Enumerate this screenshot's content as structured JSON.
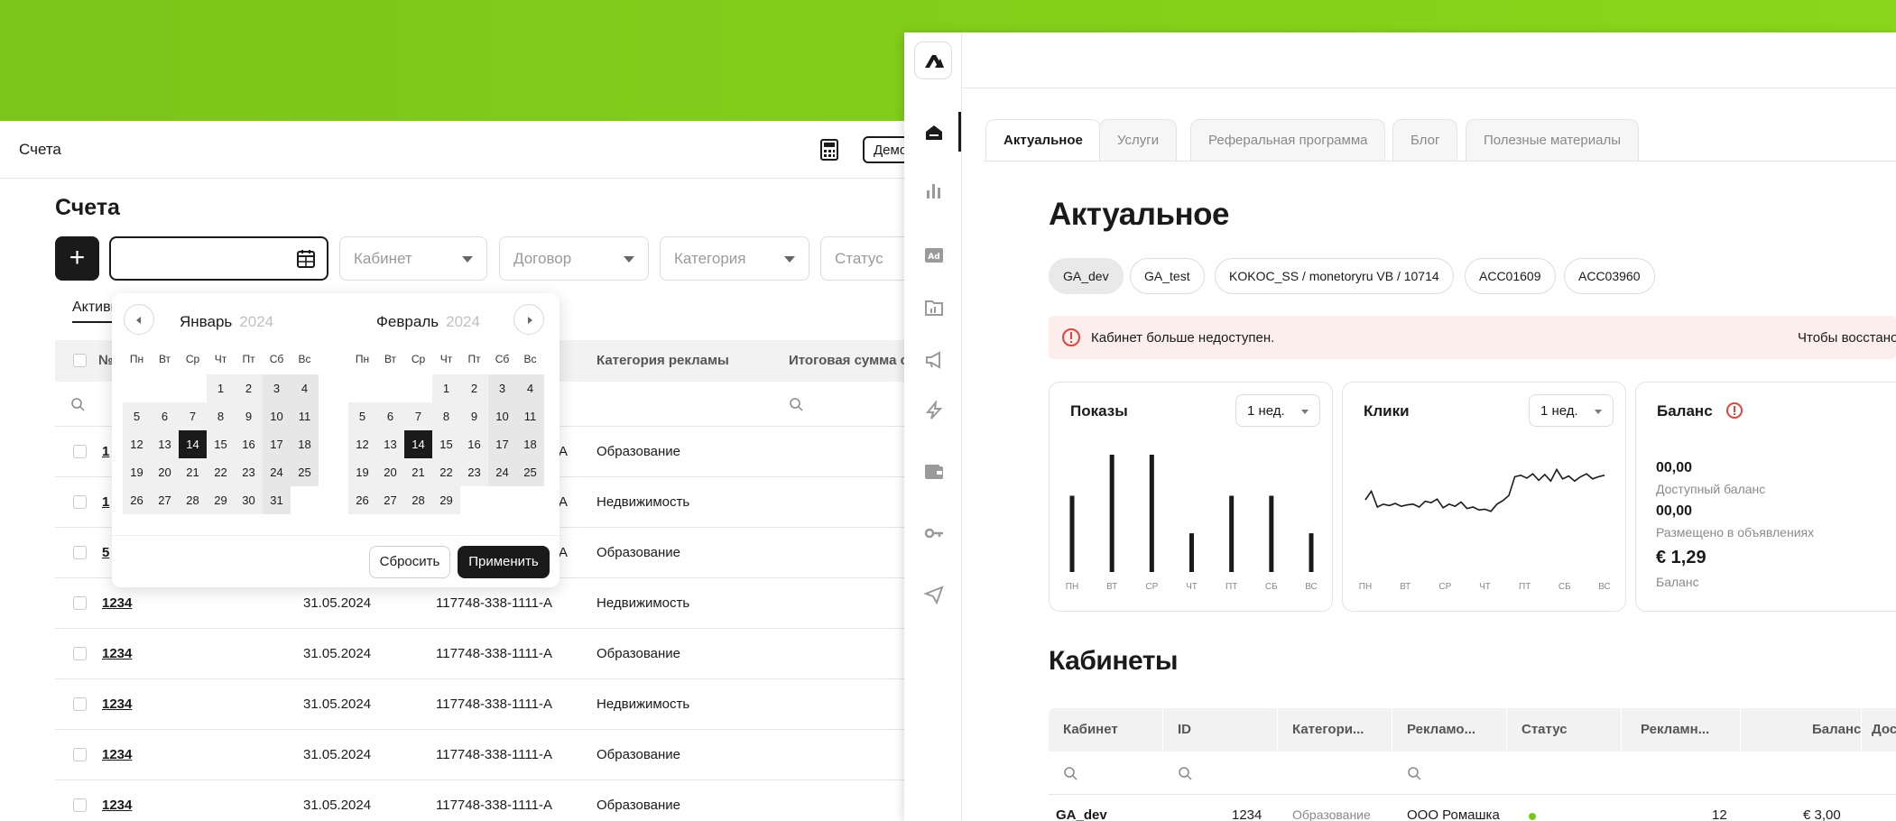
{
  "colors": {
    "brand_green": "#7cc519",
    "dark": "#1a1a1a",
    "alert_bg": "#fdeeee",
    "alert_red": "#e0433b"
  },
  "left": {
    "header_title": "Счета",
    "demo_label": "Демо",
    "page_title": "Счета",
    "add_label": "+",
    "filters": {
      "cabinet": "Кабинет",
      "contract": "Договор",
      "category": "Категория",
      "status": "Статус"
    },
    "tab_active": "Активные",
    "table": {
      "headers": {
        "num": "№",
        "ad_category": "Категория рекламы",
        "total": "Итоговая сумма счета"
      },
      "rows": [
        {
          "num": "1",
          "cat": "Образование",
          "contract_tail": "A"
        },
        {
          "num": "1",
          "cat": "Недвижимость",
          "contract_tail": "A"
        },
        {
          "num": "5",
          "cat": "Образование",
          "contract_tail": "A"
        },
        {
          "num": "1234",
          "date": "31.05.2024",
          "contract": "117748-338-1111-A",
          "cat": "Недвижимость"
        },
        {
          "num": "1234",
          "date": "31.05.2024",
          "contract": "117748-338-1111-A",
          "cat": "Образование"
        },
        {
          "num": "1234",
          "date": "31.05.2024",
          "contract": "117748-338-1111-A",
          "cat": "Недвижимость"
        },
        {
          "num": "1234",
          "date": "31.05.2024",
          "contract": "117748-338-1111-A",
          "cat": "Образование"
        },
        {
          "num": "1234",
          "date": "31.05.2024",
          "contract": "117748-338-1111-A",
          "cat": "Образование"
        }
      ]
    }
  },
  "picker": {
    "weekdays": [
      "Пн",
      "Вт",
      "Ср",
      "Чт",
      "Пт",
      "Сб",
      "Вс"
    ],
    "month1": {
      "name": "Январь",
      "year": "2024"
    },
    "month2": {
      "name": "Февраль",
      "year": "2024"
    },
    "selected_day": "14",
    "reset_label": "Сбросить",
    "apply_label": "Применить"
  },
  "right": {
    "tabs": [
      "Актуальное",
      "Услуги",
      "Реферальная программа",
      "Блог",
      "Полезные материалы"
    ],
    "title": "Актуальное",
    "chips": [
      "GA_dev",
      "GA_test",
      "KOKOC_SS / monetoryru VB / 10714",
      "ACC01609",
      "ACC03960"
    ],
    "alert_text": "Кабинет больше недоступен.",
    "alert_text2": "Чтобы восстано",
    "cards": {
      "shows": {
        "title": "Показы",
        "period": "1 нед."
      },
      "clicks": {
        "title": "Клики",
        "period": "1 нед."
      },
      "balance": {
        "title": "Баланс",
        "available_value": "00,00",
        "available_label": "Доступный баланс",
        "placed_value": "00,00",
        "placed_label": "Размещено в объявлениях",
        "balance_value": "€ 1,29",
        "balance_label": "Баланс"
      }
    },
    "day_labels": [
      "ПН",
      "ВТ",
      "СР",
      "ЧТ",
      "ПТ",
      "СБ",
      "ВС"
    ],
    "cabinets_title": "Кабинеты",
    "cab_headers": [
      "Кабинет",
      "ID",
      "Категори...",
      "Рекламо...",
      "Статус",
      "Рекламн...",
      "Баланс",
      "Дос"
    ],
    "cab_row": {
      "name": "GA_dev",
      "id": "1234",
      "cat": "Образование",
      "adv": "ООО Ромашка",
      "ads": "12",
      "balance": "€ 3,00"
    }
  },
  "chart_data": [
    {
      "type": "bar",
      "title": "Показы",
      "categories": [
        "ПН",
        "ВТ",
        "СР",
        "ЧТ",
        "ПТ",
        "СБ",
        "ВС"
      ],
      "values": [
        65,
        100,
        100,
        33,
        65,
        65,
        33
      ],
      "ylim": [
        0,
        100
      ]
    },
    {
      "type": "line",
      "title": "Клики",
      "x": [
        0,
        1,
        2,
        3,
        4,
        5,
        6,
        7,
        8,
        9,
        10,
        11,
        12,
        13,
        14,
        15,
        16,
        17,
        18,
        19,
        20,
        21,
        22,
        23,
        24,
        25,
        26,
        27,
        28,
        29,
        30,
        31,
        32,
        33,
        34,
        35,
        36,
        37,
        38,
        39,
        40
      ],
      "values": [
        50,
        62,
        40,
        44,
        42,
        45,
        41,
        43,
        44,
        40,
        48,
        46,
        51,
        39,
        44,
        41,
        47,
        38,
        40,
        36,
        37,
        34,
        44,
        49,
        56,
        82,
        84,
        80,
        86,
        77,
        85,
        76,
        92,
        79,
        83,
        76,
        82,
        86,
        79,
        82,
        84
      ],
      "ylim": [
        0,
        100
      ],
      "categories": [
        "ПН",
        "ВТ",
        "СР",
        "ЧТ",
        "ПТ",
        "СБ",
        "ВС"
      ]
    }
  ]
}
